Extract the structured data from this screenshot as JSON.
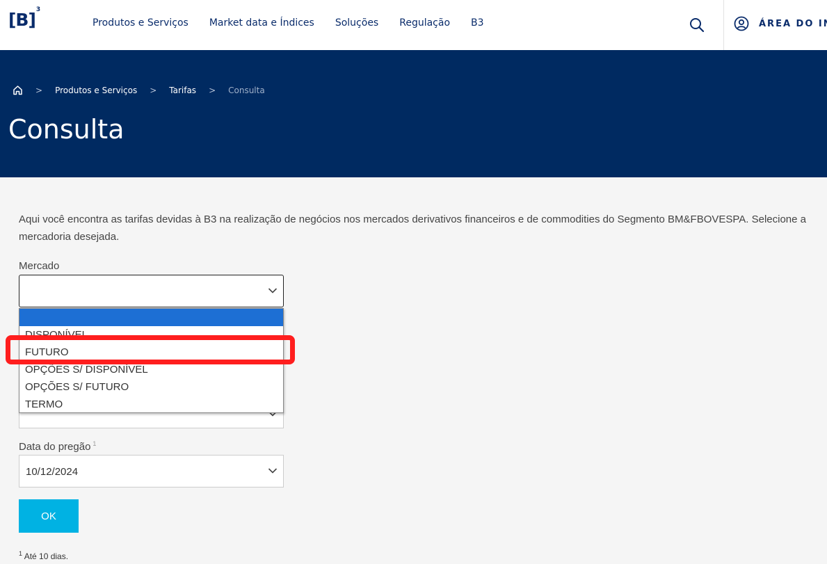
{
  "header": {
    "logo_text": "[B]",
    "logo_sup": "3",
    "nav": [
      "Produtos e Serviços",
      "Market data e Índices",
      "Soluções",
      "Regulação",
      "B3"
    ],
    "area_label": "ÁREA DO INVE",
    "brand_color": "#0a2c6b"
  },
  "banner": {
    "background": "#002a61",
    "breadcrumb": [
      "Produtos e Serviços",
      "Tarifas",
      "Consulta"
    ],
    "title": "Consulta"
  },
  "content": {
    "intro": "Aqui você encontra as tarifas devidas à B3 na realização de negócios nos mercados derivativos financeiros e de commodities do Segmento BM&FBOVESPA. Selecione a mercadoria desejada.",
    "mercado_label": "Mercado",
    "mercado_value": "",
    "mercado_options": [
      "",
      "DISPONÍVEL",
      "FUTURO",
      "OPÇÕES S/ DISPONÍVEL",
      "OPÇÕES S/ FUTURO",
      "TERMO"
    ],
    "mercado_selected_index": 0,
    "highlighted_option": "FUTURO",
    "data_label": "Data do pregão",
    "data_label_sup": "1",
    "data_value": "10/12/2024",
    "ok_label": "OK",
    "ok_color": "#00b2e3",
    "footnote_sup": "1",
    "footnote_text": "Até 10 dias."
  }
}
